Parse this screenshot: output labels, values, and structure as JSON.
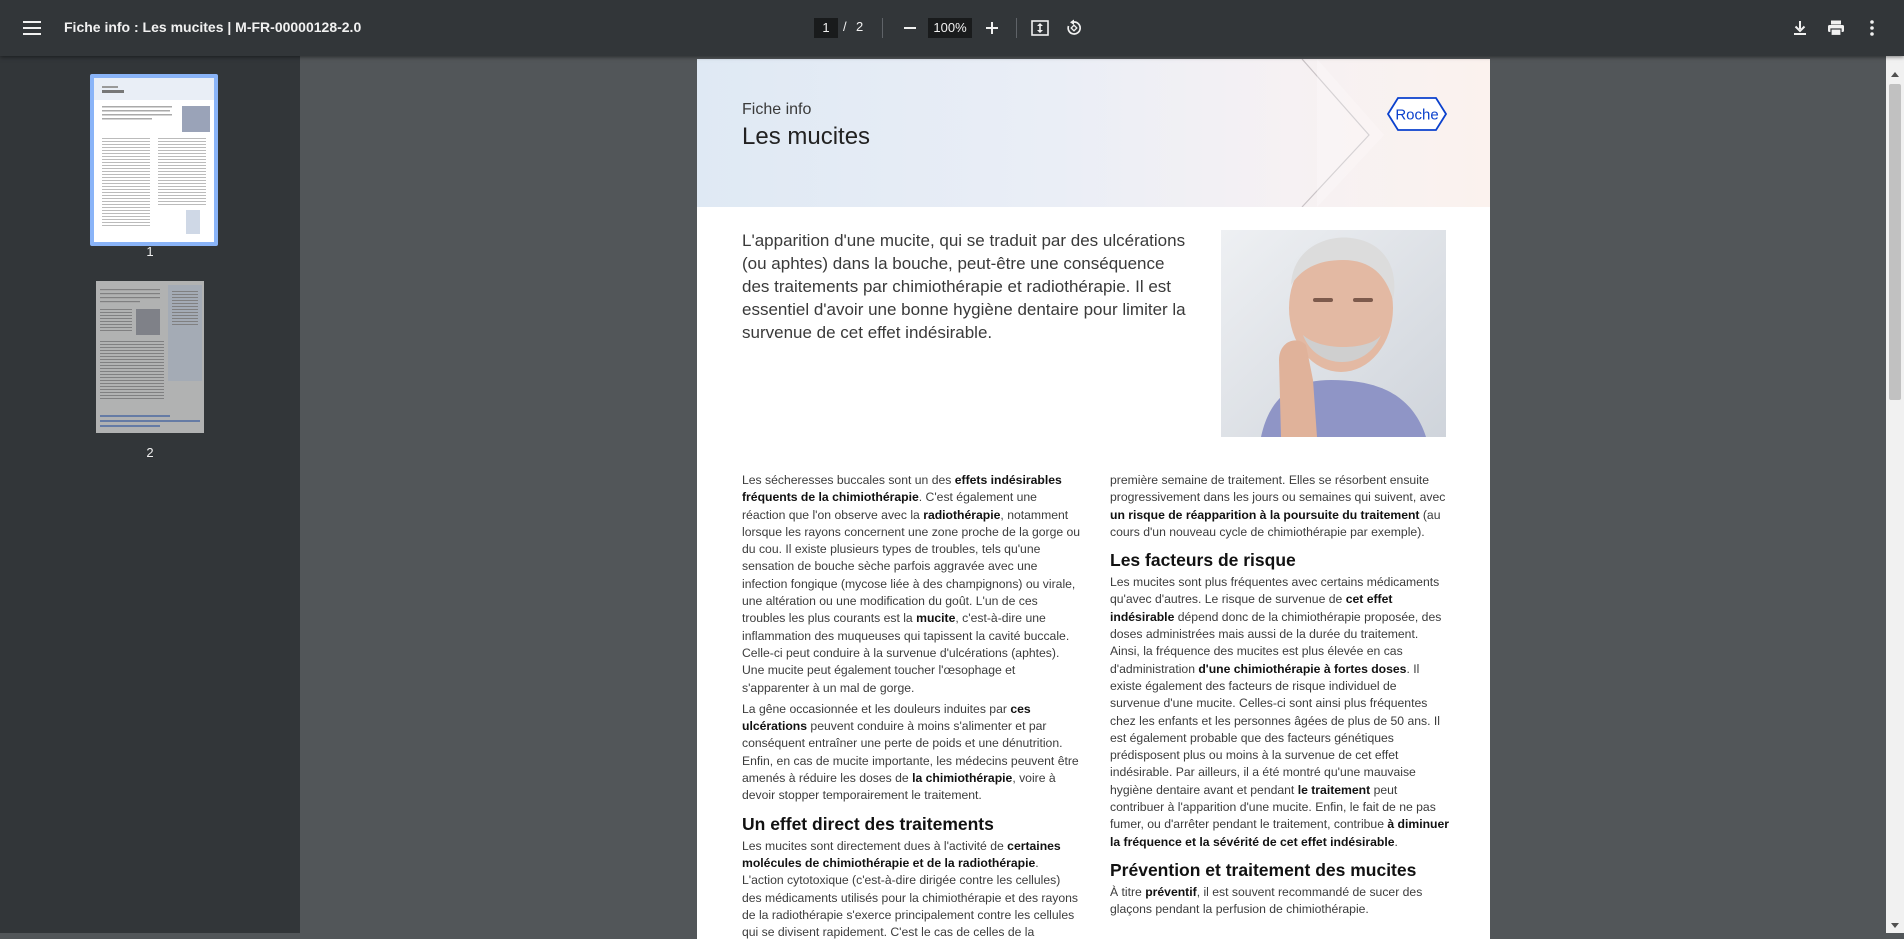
{
  "toolbar": {
    "title": "Fiche info : Les mucites | M-FR-00000128-2.0",
    "current_page": "1",
    "page_separator": "/",
    "total_pages": "2",
    "zoom": "100%"
  },
  "sidebar": {
    "thumbnails": [
      {
        "label": "1",
        "selected": true
      },
      {
        "label": "2",
        "selected": false
      }
    ]
  },
  "doc": {
    "header": {
      "label": "Fiche info",
      "title": "Les mucites",
      "logo_text": "Roche"
    },
    "intro": "L'apparition d'une mucite, qui se traduit par des ulcérations (ou aphtes) dans la bouche, peut-être une conséquence des traitements par chimiothérapie et radiothérapie. Il est essentiel d'avoir une bonne hygiène dentaire pour limiter la survenue de cet effet indésirable.",
    "left": {
      "p1": [
        "Les sécheresses buccales sont un des ",
        "effets indésirables fréquents de la chimiothérapie",
        ". C'est également une réaction que l'on observe avec la ",
        "radiothérapie",
        ", notamment lorsque les rayons concernent une zone proche de la gorge ou du cou. Il existe plusieurs types de troubles, tels qu'une sensation de bouche sèche parfois aggravée avec une infection fongique (mycose liée à des champignons) ou virale, une altération ou une modification du goût. L'un de ces troubles les plus courants est la ",
        "mucite",
        ", c'est-à-dire une inflammation des muqueuses qui tapissent la cavité buccale. Celle-ci peut conduire à la survenue d'ulcérations (aphtes). Une mucite peut également toucher l'œsophage et s'apparenter à un mal de gorge."
      ],
      "p2": [
        "La gêne occasionnée et les douleurs induites par ",
        "ces ulcérations",
        " peuvent conduire à moins s'alimenter et par conséquent entraîner une perte de poids et une dénutrition. Enfin, en cas de mucite importante, les médecins peuvent être amenés à réduire les doses de ",
        "la chimiothérapie",
        ", voire à devoir stopper temporairement le traitement."
      ],
      "h2": "Un effet direct des traitements",
      "p3": [
        "Les mucites sont directement dues à l'activité de ",
        "certaines molécules de chimiothérapie et de la radiothérapie",
        ". L'action cytotoxique (c'est-à-dire dirigée contre les cellules) des médicaments utilisés pour la chimiothérapie et des rayons de la radiothérapie s'exerce principalement contre les cellules qui se divisent rapidement. C'est le cas de celles de la muqueuse buccale. Les lésions apparaissent généralement dès la"
      ]
    },
    "right": {
      "p1": [
        "première semaine de traitement. Elles se résorbent ensuite progressivement dans les jours ou semaines qui suivent, avec ",
        "un risque de réapparition à la poursuite du traitement",
        " (au cours d'un nouveau cycle de chimiothérapie par exemple)."
      ],
      "h2a": "Les facteurs de risque",
      "p2": [
        "Les mucites sont plus fréquentes avec certains médicaments qu'avec d'autres. Le risque de survenue de ",
        "cet effet indésirable",
        " dépend donc de la chimiothérapie proposée, des doses administrées mais aussi de la durée du traitement. Ainsi, la fréquence des mucites est plus élevée en cas d'administration ",
        "d'une chimiothérapie à fortes doses",
        ". Il existe également des facteurs de risque individuel de survenue d'une mucite. Celles-ci sont ainsi plus fréquentes chez les enfants et les personnes âgées de plus de 50 ans. Il est également probable que des facteurs génétiques prédisposent plus ou moins à la survenue de cet effet indésirable. Par ailleurs, il a été montré qu'une mauvaise hygiène dentaire avant et pendant ",
        "le traitement",
        " peut contribuer à l'apparition d'une mucite. Enfin, le fait de ne pas fumer, ou d'arrêter pendant le traitement, contribue ",
        "à diminuer la fréquence et la sévérité de cet effet indésirable",
        "."
      ],
      "h2b": "Prévention et traitement des mucites",
      "p3": [
        "À titre ",
        "préventif",
        ", il est souvent recommandé de sucer des glaçons pendant la perfusion de chimiothérapie."
      ]
    }
  }
}
